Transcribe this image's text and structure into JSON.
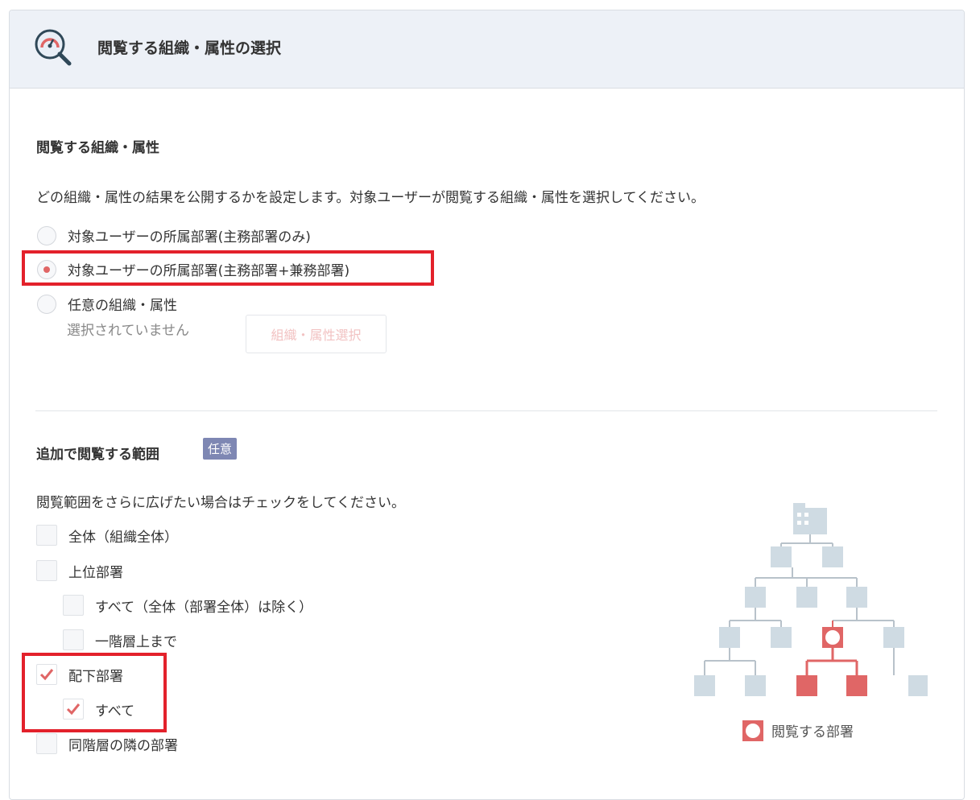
{
  "header": {
    "title": "閲覧する組織・属性の選択",
    "icon": "search-gauge-icon"
  },
  "org_section": {
    "title": "閲覧する組織・属性",
    "description": "どの組織・属性の結果を公開するかを設定します。対象ユーザーが閲覧する組織・属性を選択してください。",
    "options": [
      {
        "label": "対象ユーザーの所属部署(主務部署のみ)",
        "checked": false
      },
      {
        "label": "対象ユーザーの所属部署(主務部署+兼務部署)",
        "checked": true
      },
      {
        "label": "任意の組織・属性",
        "checked": false
      }
    ],
    "custom_status": "選択されていません",
    "select_button": "組織・属性選択"
  },
  "additional_section": {
    "title": "追加で閲覧する範囲",
    "badge": "任意",
    "description": "閲覧範囲をさらに広げたい場合はチェックをしてください。",
    "checkboxes": [
      {
        "label": "全体（組織全体）",
        "checked": false
      },
      {
        "label": "上位部署",
        "checked": false
      },
      {
        "label": "すべて（全体（部署全体）は除く）",
        "checked": false
      },
      {
        "label": "一階層上まで",
        "checked": false
      },
      {
        "label": "配下部署",
        "checked": true
      },
      {
        "label": "すべて",
        "checked": true
      },
      {
        "label": "同階層の隣の部署",
        "checked": false
      }
    ]
  },
  "diagram": {
    "legend": "閲覧する部署"
  },
  "colors": {
    "accent": "#e06666",
    "highlight": "#e3212b",
    "badge": "#7e87b3",
    "node": "#cfdbe3"
  }
}
